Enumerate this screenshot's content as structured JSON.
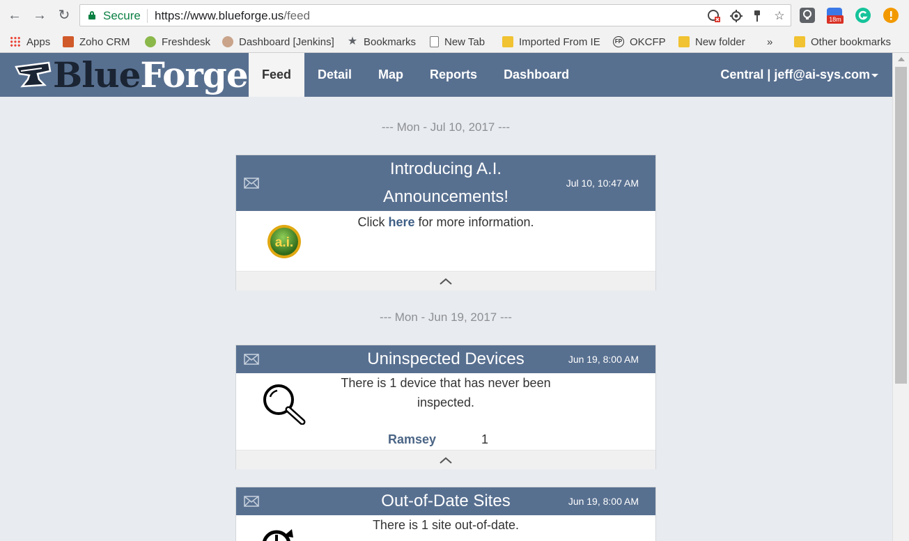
{
  "browser": {
    "secure_label": "Secure",
    "url_host": "https://www.blueforge.us",
    "url_path": "/feed",
    "extension_badge": "18m",
    "bookmarks": [
      {
        "label": "Apps"
      },
      {
        "label": "Zoho CRM"
      },
      {
        "label": "Freshdesk"
      },
      {
        "label": "Dashboard [Jenkins]"
      },
      {
        "label": "Bookmarks"
      },
      {
        "label": "New Tab"
      },
      {
        "label": "Imported From IE"
      },
      {
        "label": "OKCFP"
      },
      {
        "label": "New folder"
      },
      {
        "label": "Other bookmarks"
      }
    ],
    "overflow_label": "»"
  },
  "app": {
    "logo_part1": "Blue",
    "logo_part2": "Forge",
    "nav": [
      {
        "label": "Feed",
        "active": true
      },
      {
        "label": "Detail"
      },
      {
        "label": "Map"
      },
      {
        "label": "Reports"
      },
      {
        "label": "Dashboard"
      }
    ],
    "user_label": "Central | jeff@ai-sys.com"
  },
  "feed": {
    "groups": [
      {
        "date": "--- Mon - Jul 10, 2017 ---",
        "card": {
          "title": "Introducing A.I. Announcements!",
          "time": "Jul 10, 10:47 AM",
          "text_before": "Click ",
          "link": "here",
          "text_after": " for more information.",
          "icon": "ai-badge-icon",
          "icon_text": "a.i."
        }
      },
      {
        "date": "--- Mon - Jun 19, 2017 ---",
        "cards": [
          {
            "title": "Uninspected Devices",
            "time": "Jun 19, 8:00 AM",
            "text": "There is 1 device that has never been inspected.",
            "icon": "magnifier-icon",
            "rows": [
              {
                "name": "Ramsey",
                "value": "1"
              }
            ]
          },
          {
            "title": "Out-of-Date Sites",
            "time": "Jun 19, 8:00 AM",
            "text": "There is 1 site out-of-date.",
            "icon": "clock-icon"
          }
        ]
      }
    ]
  },
  "colors": {
    "header": "#587090",
    "background": "#e8ebef",
    "link": "#3f5f86",
    "secure_green": "#0b8043"
  }
}
